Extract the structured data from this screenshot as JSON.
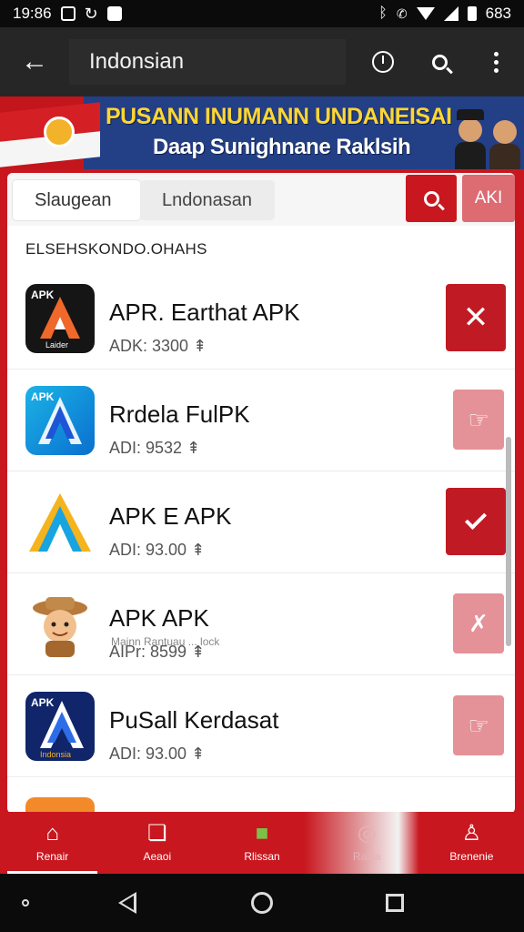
{
  "status_bar": {
    "time": "19:86",
    "battery_text": "683"
  },
  "toolbar": {
    "title": "Indonsian"
  },
  "banner": {
    "title": "PUSANN INUMANN UNDANEISAI",
    "subtitle": "Daap Sunighnane Raklsih",
    "colors": {
      "red": "#c3151c",
      "blue": "#233f86",
      "yellow": "#ffd633"
    }
  },
  "search": {
    "segment_active": "Slaugean",
    "segment_inactive": "Lndonasan",
    "aki_label": "AKI"
  },
  "section_label": "ELSEHSKONDO.OHAHS",
  "apps": [
    {
      "name": "APR. Earthat APK",
      "meta": "ADK: 3300",
      "icon_text": "APK",
      "icon_caption": "Laider",
      "action": "close-icon",
      "action_style": "dark"
    },
    {
      "name": "Rrdela FulPK",
      "meta": "ADI: 9532",
      "icon_text": "APK",
      "action": "hand-icon",
      "action_style": "light"
    },
    {
      "name": "APK E APK",
      "meta": "ADI: 93.00",
      "icon_text": "A",
      "action": "check-icon",
      "action_style": "dark"
    },
    {
      "name": "APK APK",
      "sub": "Mainn Rantuau ... lock",
      "meta": "AIPr: 8599",
      "icon_text": "",
      "action": "pin-icon",
      "action_style": "light"
    },
    {
      "name": "PuSall Kerdasat",
      "meta": "ADI: 93.00",
      "icon_text": "APK",
      "icon_caption": "Indonsia",
      "action": "hand-icon",
      "action_style": "light"
    }
  ],
  "meta_suffix": "⇞",
  "bottom_nav": [
    {
      "label": "Renair",
      "icon": "home-icon",
      "active": true
    },
    {
      "label": "Aeaoi",
      "icon": "chat-icon",
      "active": false
    },
    {
      "label": "Rlissan",
      "icon": "app-grid-icon",
      "active": false
    },
    {
      "label": "Ralsa",
      "icon": "globe-icon",
      "active": false,
      "faded": true
    },
    {
      "label": "Brenenie",
      "icon": "person-icon",
      "active": false
    }
  ],
  "colors": {
    "primary_red": "#c8171f",
    "light_red": "#e49298",
    "dark_red": "#c01a24"
  }
}
